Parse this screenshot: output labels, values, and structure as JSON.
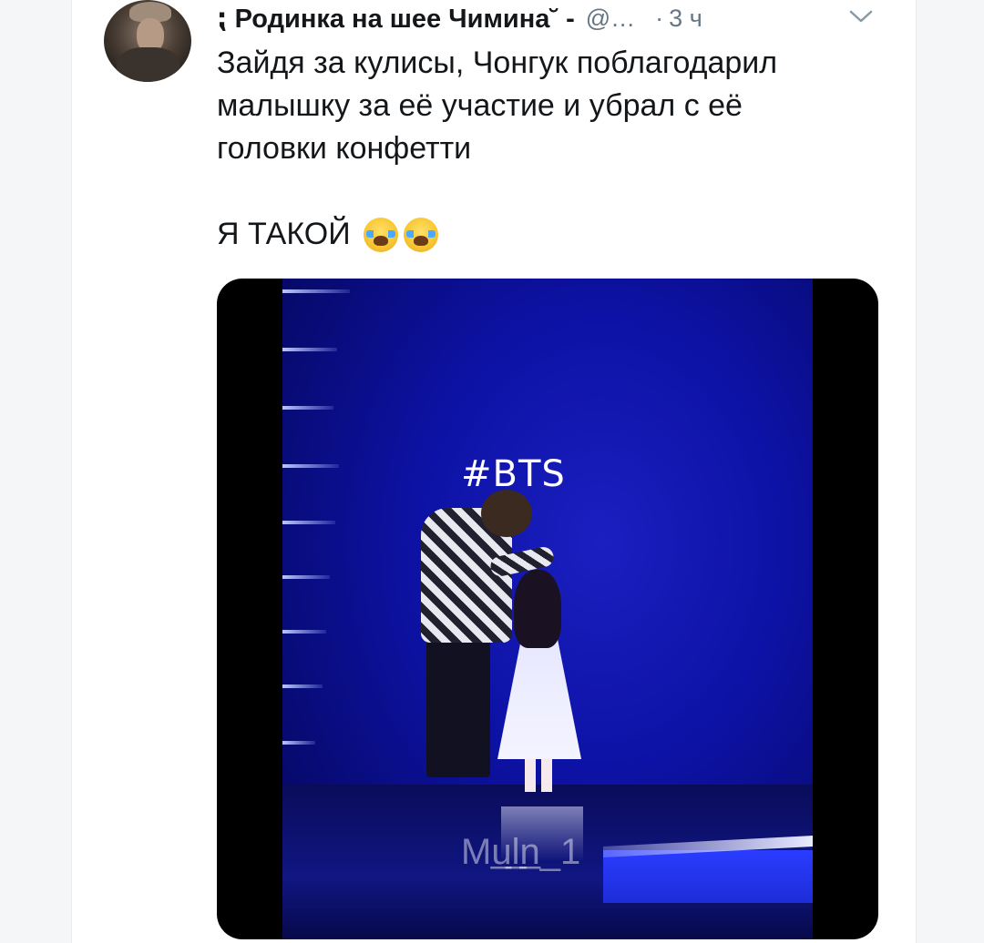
{
  "tweet": {
    "display_name": "⁏ Родинка на шее Чимина˘ ‐",
    "handle": "@…",
    "separator": "·",
    "time": "3 ч",
    "text_line1": "Зайдя за кулисы, Чонгук поблагодарил малышку за её участие и убрал с её головки конфетти",
    "text_line2": "Я ТАКОЙ",
    "emoji": [
      "loudly-crying-face",
      "loudly-crying-face"
    ]
  },
  "media": {
    "hashtag_overlay": "#BTS",
    "watermark": "Mu̲l̲n̲_1"
  },
  "colors": {
    "text": "#14171a",
    "secondary": "#657786",
    "stage_blue": "#0d12a6"
  }
}
